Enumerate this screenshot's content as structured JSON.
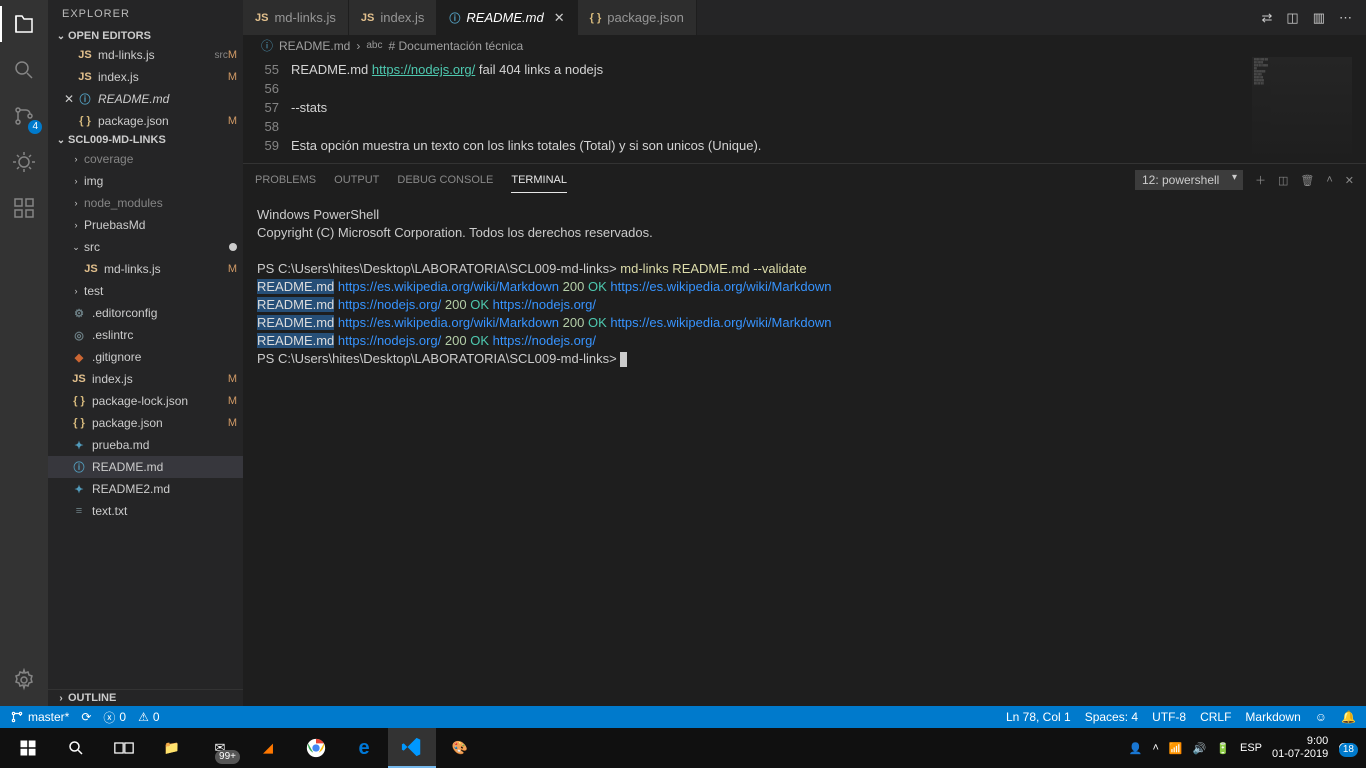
{
  "sidebar": {
    "title": "EXPLORER",
    "openEditorsLabel": "OPEN EDITORS",
    "openEditors": [
      {
        "icon": "JS",
        "iconCls": "js",
        "name": "md-links.js",
        "meta": "src",
        "m": "M"
      },
      {
        "icon": "JS",
        "iconCls": "js",
        "name": "index.js",
        "meta": "",
        "m": "M"
      },
      {
        "icon": "ⓘ",
        "iconCls": "md-ic",
        "name": "README.md",
        "meta": "",
        "m": "",
        "close": true,
        "italic": true
      },
      {
        "icon": "{ }",
        "iconCls": "json-ic",
        "name": "package.json",
        "meta": "",
        "m": "M"
      }
    ],
    "projectLabel": "SCL009-MD-LINKS",
    "tree": [
      {
        "chev": "›",
        "name": "coverage",
        "dim": true,
        "indent": "indent1"
      },
      {
        "chev": "›",
        "name": "img",
        "dim": false,
        "indent": "indent1"
      },
      {
        "chev": "›",
        "name": "node_modules",
        "dim": true,
        "indent": "indent1"
      },
      {
        "chev": "›",
        "name": "PruebasMd",
        "dim": false,
        "indent": "indent1"
      },
      {
        "chev": "⌄",
        "name": "src",
        "dim": false,
        "indent": "indent1",
        "dot": true
      },
      {
        "icon": "JS",
        "iconCls": "js",
        "name": "md-links.js",
        "indent": "indent2",
        "m": "M"
      },
      {
        "chev": "›",
        "name": "test",
        "dim": false,
        "indent": "indent1"
      },
      {
        "icon": "⚙",
        "iconCls": "cfg-ic",
        "name": ".editorconfig",
        "indent": "indent1"
      },
      {
        "icon": "◎",
        "iconCls": "cfg-ic",
        "name": ".eslintrc",
        "indent": "indent1"
      },
      {
        "icon": "◆",
        "iconCls": "git-ic",
        "name": ".gitignore",
        "indent": "indent1"
      },
      {
        "icon": "JS",
        "iconCls": "js",
        "name": "index.js",
        "indent": "indent1",
        "m": "M"
      },
      {
        "icon": "{ }",
        "iconCls": "json-ic",
        "name": "package-lock.json",
        "indent": "indent1",
        "m": "M"
      },
      {
        "icon": "{ }",
        "iconCls": "json-ic",
        "name": "package.json",
        "indent": "indent1",
        "m": "M"
      },
      {
        "icon": "✦",
        "iconCls": "md-ic",
        "name": "prueba.md",
        "indent": "indent1"
      },
      {
        "icon": "ⓘ",
        "iconCls": "md-ic",
        "name": "README.md",
        "indent": "indent1",
        "sel": true
      },
      {
        "icon": "✦",
        "iconCls": "md-ic",
        "name": "README2.md",
        "indent": "indent1"
      },
      {
        "icon": "≡",
        "iconCls": "cfg-ic",
        "name": "text.txt",
        "indent": "indent1"
      }
    ],
    "outlineLabel": "OUTLINE"
  },
  "tabs": [
    {
      "icon": "JS",
      "iconCls": "js",
      "label": "md-links.js"
    },
    {
      "icon": "JS",
      "iconCls": "js",
      "label": "index.js"
    },
    {
      "icon": "ⓘ",
      "iconCls": "md-ic",
      "label": "README.md",
      "active": true,
      "close": true,
      "italic": true
    },
    {
      "icon": "{ }",
      "iconCls": "json-ic",
      "label": "package.json"
    }
  ],
  "breadcrumb": {
    "file": "README.md",
    "sep": "›",
    "seg": "# Documentación técnica",
    "abcIcon": "abc"
  },
  "editor": {
    "lines": [
      {
        "n": "55",
        "html": "README.md <span class='url'>https://nodejs.org/</span> fail 404 links a nodejs"
      },
      {
        "n": "56",
        "html": ""
      },
      {
        "n": "57",
        "html": "--stats"
      },
      {
        "n": "58",
        "html": ""
      },
      {
        "n": "59",
        "html": "Esta opción muestra un texto con los links totales (Total) y si son unicos (Unique)."
      }
    ]
  },
  "panel": {
    "tabs": [
      "PROBLEMS",
      "OUTPUT",
      "DEBUG CONSOLE",
      "TERMINAL"
    ],
    "activeTab": "TERMINAL",
    "selector": "12: powershell",
    "psHeader1": "Windows PowerShell",
    "psHeader2": "Copyright (C) Microsoft Corporation. Todos los derechos reservados.",
    "prompt": "PS C:\\Users\\hites\\Desktop\\LABORATORIA\\SCL009-md-links>",
    "cmd": "md-links README.md --validate",
    "results": [
      {
        "file": "README.md",
        "url": "https://es.wikipedia.org/wiki/Markdown",
        "code": "200",
        "ok": "OK",
        "url2": "https://es.wikipedia.org/wiki/Markdown"
      },
      {
        "file": "README.md",
        "url": "https://nodejs.org/",
        "code": "200",
        "ok": "OK",
        "url2": "https://nodejs.org/"
      },
      {
        "file": "README.md",
        "url": "https://es.wikipedia.org/wiki/Markdown",
        "code": "200",
        "ok": "OK",
        "url2": "https://es.wikipedia.org/wiki/Markdown"
      },
      {
        "file": "README.md",
        "url": "https://nodejs.org/",
        "code": "200",
        "ok": "OK",
        "url2": "https://nodejs.org/"
      }
    ]
  },
  "status": {
    "branch": "master*",
    "errors": "0",
    "warnings": "0",
    "lncol": "Ln 78, Col 1",
    "spaces": "Spaces: 4",
    "enc": "UTF-8",
    "eol": "CRLF",
    "lang": "Markdown"
  },
  "activityBadge": "4",
  "taskbar": {
    "time": "9:00",
    "date": "01-07-2019",
    "lang": "ESP",
    "notif": "18",
    "mail": "99+"
  }
}
